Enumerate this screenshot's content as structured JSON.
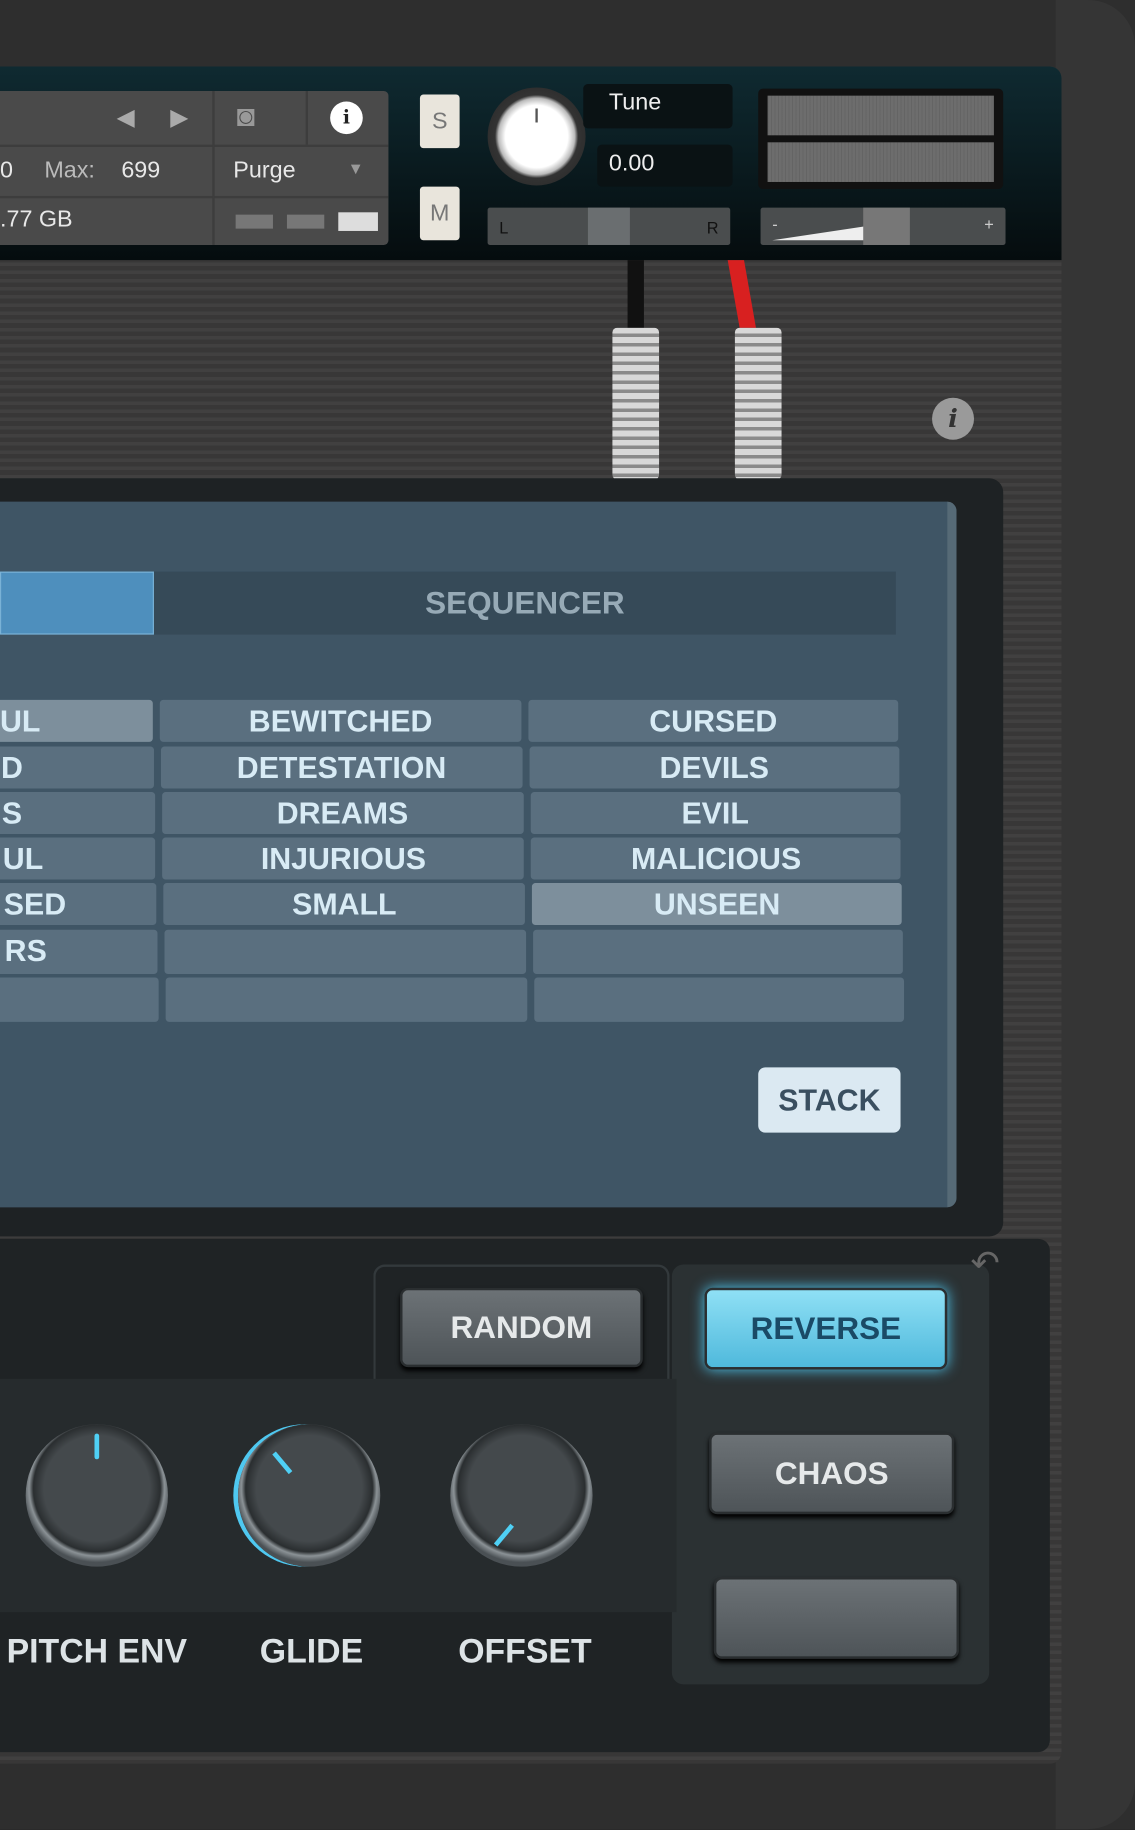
{
  "header": {
    "max_label": "Max:",
    "max_value": "699",
    "memory": ".77 GB",
    "purge": "Purge",
    "partial_left_value": "0",
    "solo": "S",
    "mute": "M",
    "tune_label": "Tune",
    "tune_value": "0.00",
    "pan_left": "L",
    "pan_right": "R",
    "vol_minus": "-",
    "vol_plus": "+"
  },
  "screen": {
    "tabs": [
      {
        "label": "",
        "active": true
      },
      {
        "label": "SEQUENCER",
        "active": false
      }
    ],
    "grid": [
      [
        "UL",
        "BEWITCHED",
        "CURSED"
      ],
      [
        "D",
        "DETESTATION",
        "DEVILS"
      ],
      [
        "S",
        "DREAMS",
        "EVIL"
      ],
      [
        "UL",
        "INJURIOUS",
        "MALICIOUS"
      ],
      [
        "SED",
        "SMALL",
        "UNSEEN"
      ],
      [
        "RS",
        "",
        ""
      ],
      [
        "",
        "",
        ""
      ]
    ],
    "selected": [
      [
        0,
        0
      ],
      [
        4,
        2
      ]
    ],
    "stack_label": "STACK"
  },
  "controls": {
    "random": "RANDOM",
    "reverse": "REVERSE",
    "reverse_active": true,
    "chaos": "CHAOS",
    "blank": "",
    "knobs": [
      {
        "label": "PITCH ENV"
      },
      {
        "label": "GLIDE"
      },
      {
        "label": "OFFSET"
      }
    ]
  },
  "colors": {
    "accent": "#4fc8f0",
    "tab_active": "#4e8fbd",
    "cable_red": "#d82020"
  }
}
